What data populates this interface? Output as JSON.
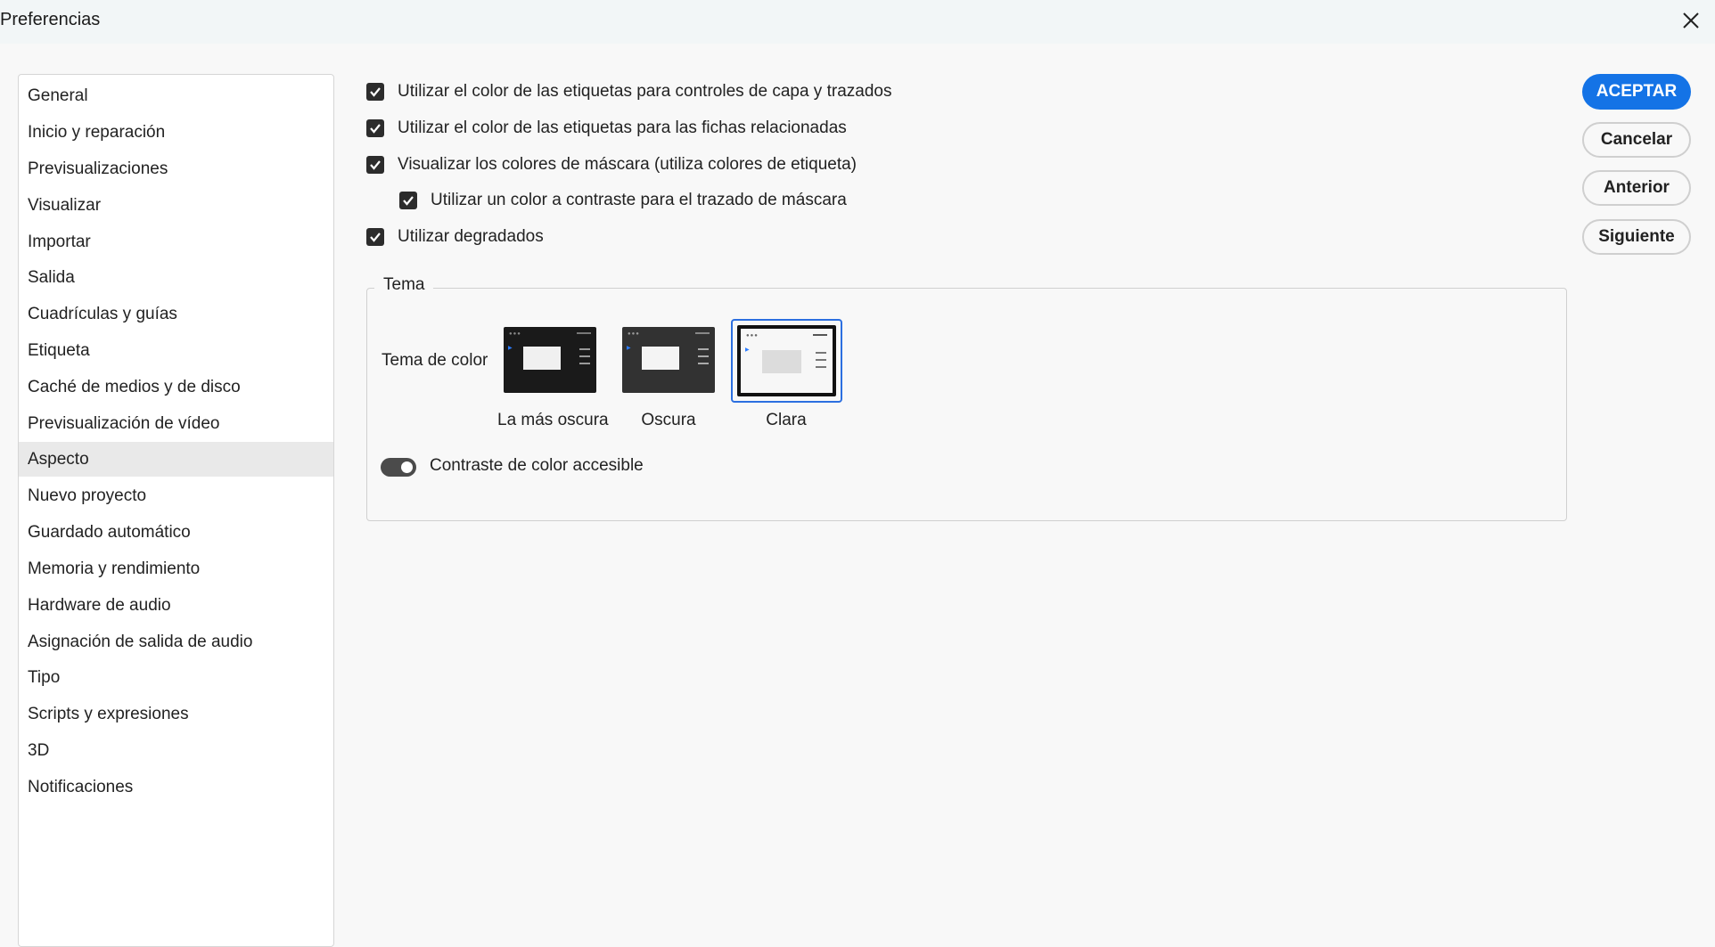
{
  "window": {
    "title": "Preferencias"
  },
  "sidebar": {
    "items": [
      {
        "label": "General"
      },
      {
        "label": "Inicio y reparación"
      },
      {
        "label": "Previsualizaciones"
      },
      {
        "label": "Visualizar"
      },
      {
        "label": "Importar"
      },
      {
        "label": "Salida"
      },
      {
        "label": "Cuadrículas y guías"
      },
      {
        "label": "Etiqueta"
      },
      {
        "label": "Caché de medios y de disco"
      },
      {
        "label": "Previsualización de vídeo"
      },
      {
        "label": "Aspecto"
      },
      {
        "label": "Nuevo proyecto"
      },
      {
        "label": "Guardado automático"
      },
      {
        "label": "Memoria y rendimiento"
      },
      {
        "label": "Hardware de audio"
      },
      {
        "label": "Asignación de salida de audio"
      },
      {
        "label": "Tipo"
      },
      {
        "label": "Scripts y expresiones"
      },
      {
        "label": "3D"
      },
      {
        "label": "Notificaciones"
      }
    ],
    "selected": "Aspecto"
  },
  "options": [
    {
      "label": "Utilizar el color de las etiquetas para controles de capa y trazados",
      "checked": true
    },
    {
      "label": "Utilizar el color de las etiquetas para las fichas relacionadas",
      "checked": true
    },
    {
      "label": "Visualizar los colores de máscara (utiliza colores de etiqueta)",
      "checked": true
    },
    {
      "label": "Utilizar un color a contraste para el trazado de máscara",
      "checked": true
    },
    {
      "label": "Utilizar degradados",
      "checked": true
    }
  ],
  "theme": {
    "legend": "Tema",
    "color_theme_label": "Tema de color",
    "options": [
      {
        "label": "La más oscura"
      },
      {
        "label": "Oscura"
      },
      {
        "label": "Clara"
      }
    ],
    "selected": "Clara",
    "accessible_contrast": {
      "label": "Contraste de color accesible",
      "on": true
    }
  },
  "buttons": {
    "accept": "ACEPTAR",
    "cancel": "Cancelar",
    "previous": "Anterior",
    "next": "Siguiente"
  },
  "colors": {
    "accent": "#1473e6",
    "selection_ring": "#2c6fe0"
  },
  "icons": {
    "close": "close-icon",
    "check": "check-icon"
  }
}
